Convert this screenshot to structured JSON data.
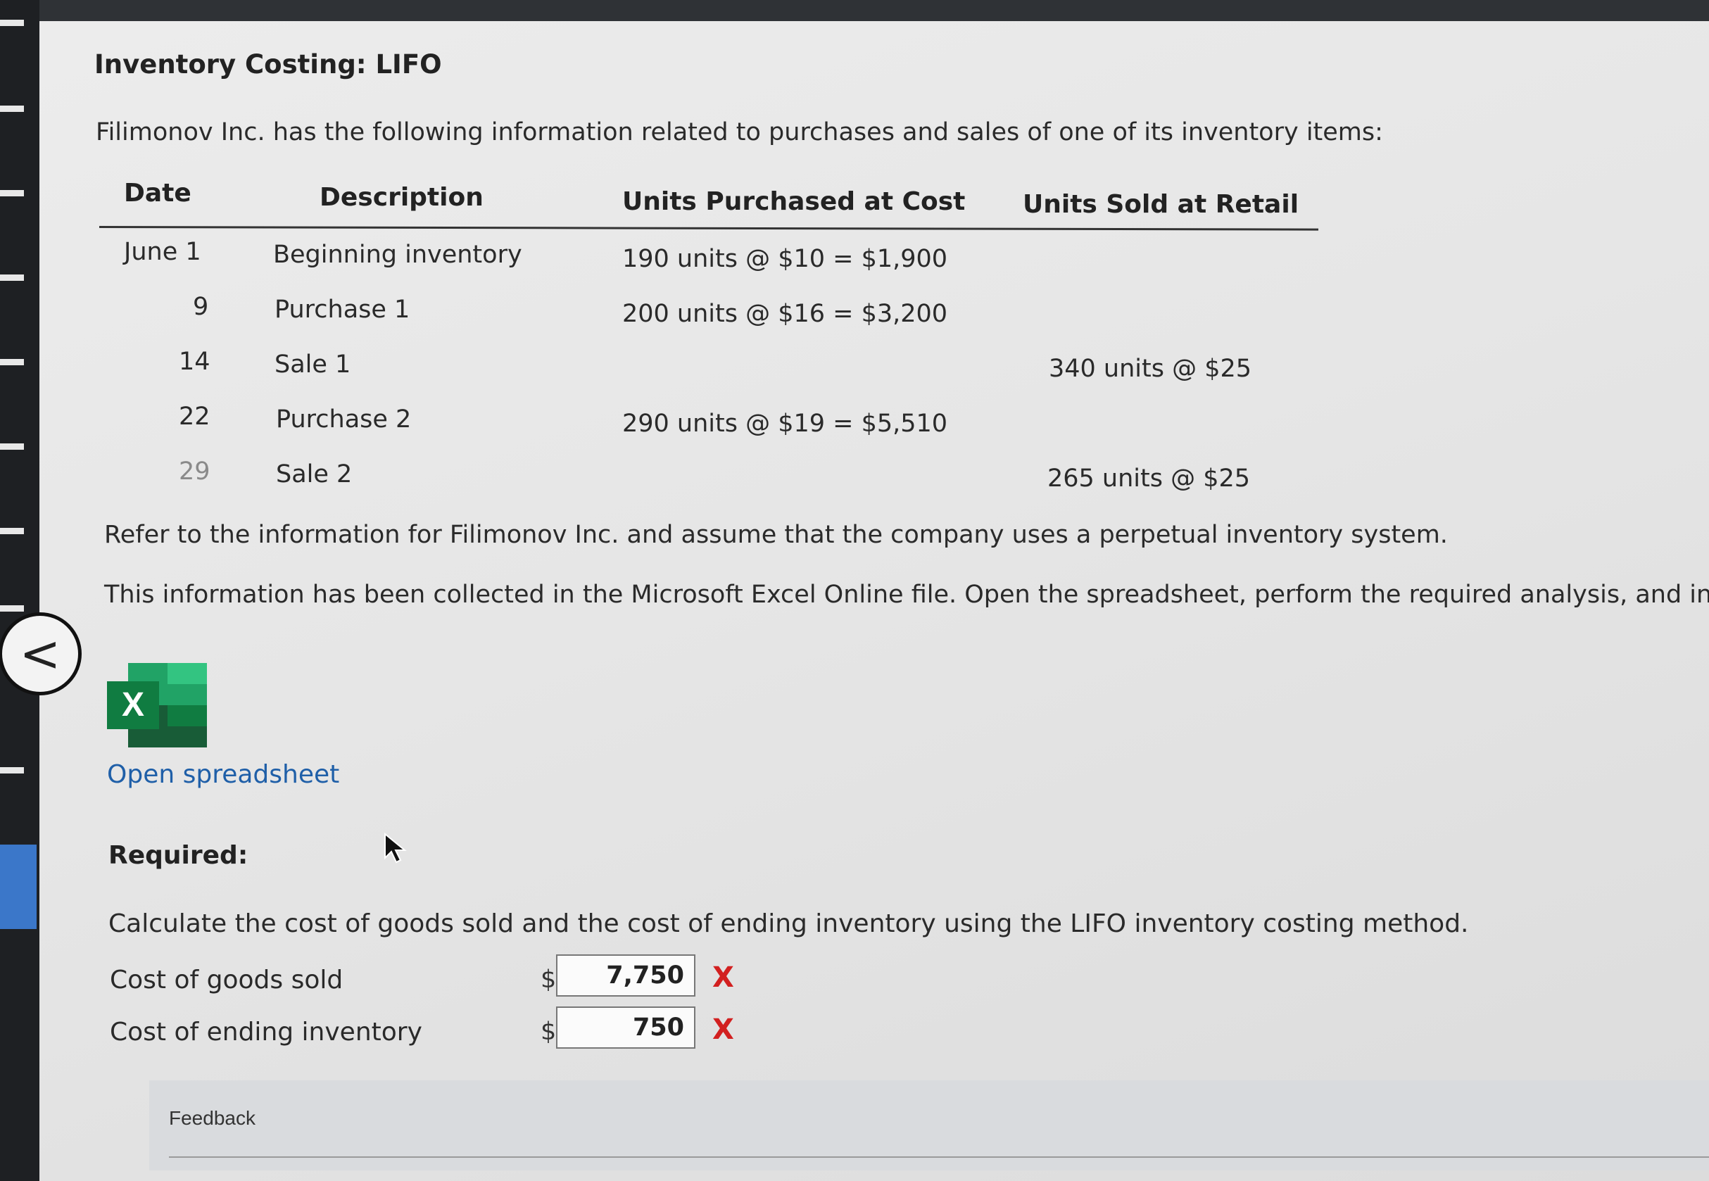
{
  "title": "Inventory Costing: LIFO",
  "intro": "Filimonov Inc. has the following information related to purchases and sales of one of its inventory items:",
  "table": {
    "headers": [
      "Date",
      "Description",
      "Units Purchased at Cost",
      "Units Sold at Retail"
    ],
    "rows": [
      {
        "date": "June 1",
        "description": "Beginning inventory",
        "purchased": "190 units @ $10 = $1,900",
        "sold": ""
      },
      {
        "date": "9",
        "description": "Purchase 1",
        "purchased": "200 units @ $16 = $3,200",
        "sold": ""
      },
      {
        "date": "14",
        "description": "Sale 1",
        "purchased": "",
        "sold": "340 units @ $25"
      },
      {
        "date": "22",
        "description": "Purchase 2",
        "purchased": "290 units @ $19 = $5,510",
        "sold": ""
      },
      {
        "date": "29",
        "description": "Sale 2",
        "purchased": "",
        "sold": "265 units @ $25"
      }
    ]
  },
  "refer_text": "Refer to the information for Filimonov Inc. and assume that the company uses a perpetual inventory system.",
  "excel_text": "This information has been collected in the Microsoft Excel Online file. Open the spreadsheet, perform the required analysis, and inpu",
  "excel_icon": {
    "icon": "excel-icon",
    "letter": "X",
    "color": "#1e7145"
  },
  "open_link": "Open spreadsheet",
  "back_glyph": "<",
  "required_label": "Required:",
  "calc_text": "Calculate the cost of goods sold and the cost of ending inventory using the LIFO inventory costing method.",
  "answers": [
    {
      "label": "Cost of goods sold",
      "currency": "$",
      "value": "7,750",
      "status_mark": "X",
      "status": "incorrect"
    },
    {
      "label": "Cost of ending inventory",
      "currency": "$",
      "value": "750",
      "status_mark": "X",
      "status": "incorrect"
    }
  ],
  "feedback_label": "Feedback",
  "colors": {
    "link": "#1f5fa8",
    "incorrect": "#d22020",
    "excel_green": "#1e7145"
  }
}
